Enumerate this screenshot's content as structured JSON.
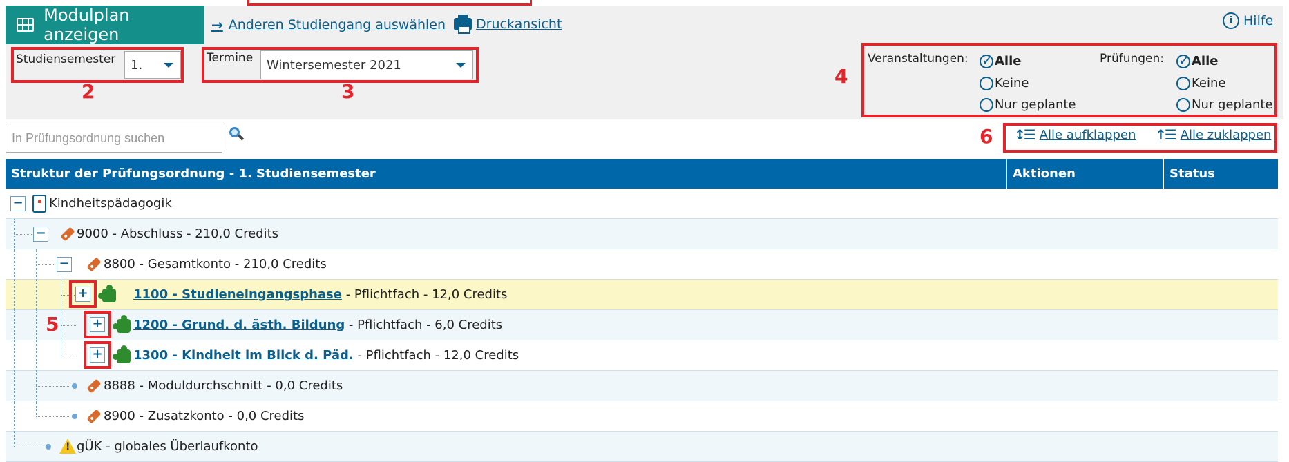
{
  "header": {
    "tab_label": "Modulplan anzeigen",
    "link_change": "Anderen Studiengang auswählen",
    "link_print": "Druckansicht",
    "help": "Hilfe"
  },
  "filters": {
    "semester_label": "Studiensemester",
    "semester_value": "1.",
    "termine_label": "Termine",
    "termine_value": "Wintersemester 2021",
    "veranstaltungen_label": "Veranstaltungen:",
    "pruefungen_label": "Prüfungen:",
    "options": [
      "Alle",
      "Keine",
      "Nur geplante"
    ],
    "selected": "Alle"
  },
  "search": {
    "placeholder": "In Prüfungsordnung suchen"
  },
  "expand": {
    "open": "Alle aufklappen",
    "close": "Alle zuklappen"
  },
  "table": {
    "columns": [
      "Struktur der Prüfungsordnung - 1. Studiensemester",
      "Aktionen",
      "Status"
    ],
    "rows": [
      {
        "text": "Kindheitspädagogik",
        "link": "",
        "suffix": ""
      },
      {
        "text": "9000 - Abschluss - 210,0 Credits",
        "link": "",
        "suffix": ""
      },
      {
        "text": "8800 - Gesamtkonto - 210,0 Credits",
        "link": "",
        "suffix": ""
      },
      {
        "text": "",
        "link": "1100 - Studieneingangsphase",
        "suffix": " - Pflichtfach - 12,0 Credits"
      },
      {
        "text": "",
        "link": "1200 - Grund. d. ästh. Bildung",
        "suffix": " - Pflichtfach - 6,0 Credits"
      },
      {
        "text": "",
        "link": "1300 - Kindheit im Blick d. Päd.",
        "suffix": " - Pflichtfach - 12,0 Credits"
      },
      {
        "text": "8888 - Moduldurchschnitt - 0,0 Credits",
        "link": "",
        "suffix": ""
      },
      {
        "text": "8900 - Zusatzkonto - 0,0 Credits",
        "link": "",
        "suffix": ""
      },
      {
        "text": "gÜK - globales Überlaufkonto",
        "link": "",
        "suffix": ""
      }
    ]
  },
  "annotations": {
    "n2": "2",
    "n3": "3",
    "n4": "4",
    "n5": "5",
    "n6": "6"
  },
  "icons": [
    "table-icon",
    "arrow-right-icon",
    "printer-icon",
    "info-icon",
    "search-icon",
    "expand-icon",
    "collapse-icon",
    "book-icon",
    "tag-icon",
    "puzzle-icon",
    "warning-icon"
  ],
  "colors": {
    "accent": "#158f8a",
    "header": "#0068a8",
    "link": "#0a5f8c",
    "highlight": "#fcf7c6",
    "annotation": "#e0262d"
  }
}
